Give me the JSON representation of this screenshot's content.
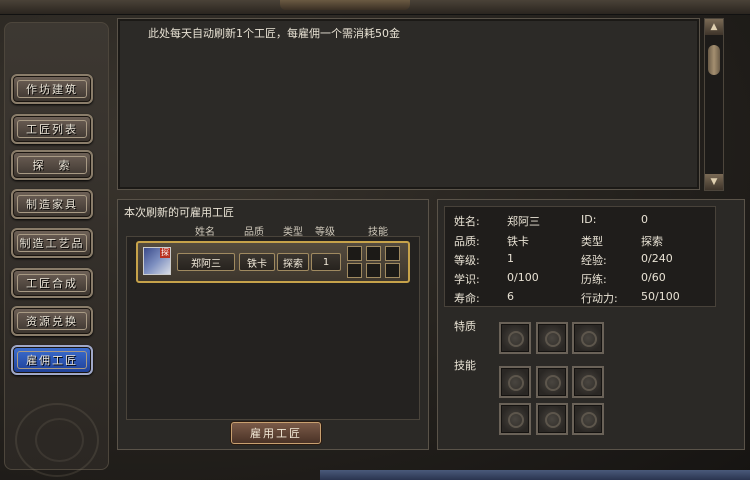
{
  "message": "此处每天自动刷新1个工匠，每雇佣一个需消耗50金",
  "nav": [
    {
      "label": "作坊建筑",
      "name": "nav-workshop-building"
    },
    {
      "label": "工匠列表",
      "name": "nav-artisan-list"
    },
    {
      "label": "探　索",
      "name": "nav-explore"
    },
    {
      "label": "制造家具",
      "name": "nav-make-furniture"
    },
    {
      "label": "制造工艺品",
      "name": "nav-make-crafts"
    },
    {
      "label": "工匠合成",
      "name": "nav-artisan-merge"
    },
    {
      "label": "资源兑换",
      "name": "nav-resource-exchange"
    },
    {
      "label": "雇佣工匠",
      "name": "nav-hire-artisan"
    }
  ],
  "list": {
    "title": "本次刷新的可雇用工匠",
    "columns": {
      "name": "姓名",
      "quality": "品质",
      "type": "类型",
      "level": "等级",
      "skill": "技能"
    },
    "row": {
      "name": "郑阿三",
      "quality": "铁卡",
      "type": "探索",
      "level": "1",
      "avatar_tag": "探"
    },
    "hire_button": "雇用工匠"
  },
  "info": {
    "name_label": "姓名:",
    "name": "郑阿三",
    "id_label": "ID:",
    "id": "0",
    "quality_label": "品质:",
    "quality": "铁卡",
    "type_label": "类型",
    "type": "探索",
    "level_label": "等级:",
    "level": "1",
    "exp_label": "经验:",
    "exp": "0/240",
    "study_label": "学识:",
    "study": "0/100",
    "training_label": "历练:",
    "training": "0/60",
    "life_label": "寿命:",
    "life": "6",
    "action_label": "行动力:",
    "action": "50/100",
    "trait_label": "特质",
    "skill_label": "技能"
  }
}
